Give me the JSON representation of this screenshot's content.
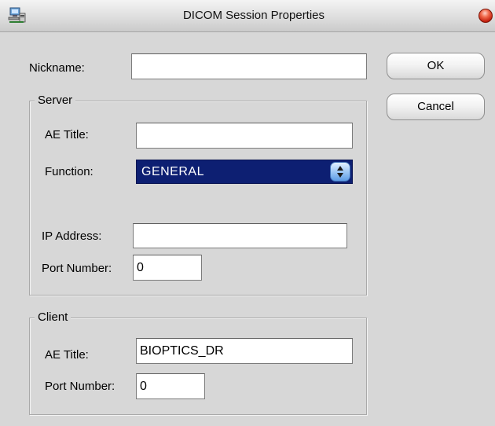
{
  "window": {
    "title": "DICOM Session Properties",
    "app_icon": "network-computer-icon",
    "close_icon": "close-icon"
  },
  "form": {
    "nickname": {
      "label": "Nickname:",
      "value": ""
    },
    "server": {
      "legend": "Server",
      "ae_title": {
        "label": "AE Title:",
        "value": ""
      },
      "function": {
        "label": "Function:",
        "selected": "GENERAL"
      },
      "ip_address": {
        "label": "IP Address:",
        "value": ""
      },
      "port_number": {
        "label": "Port Number:",
        "value": "0"
      }
    },
    "client": {
      "legend": "Client",
      "ae_title": {
        "label": "AE Title:",
        "value": "BIOPTICS_DR"
      },
      "port_number": {
        "label": "Port Number:",
        "value": "0"
      }
    }
  },
  "buttons": {
    "ok": "OK",
    "cancel": "Cancel"
  },
  "colors": {
    "selected_bg": "#0d1f72",
    "window_bg": "#d7d7d7"
  }
}
